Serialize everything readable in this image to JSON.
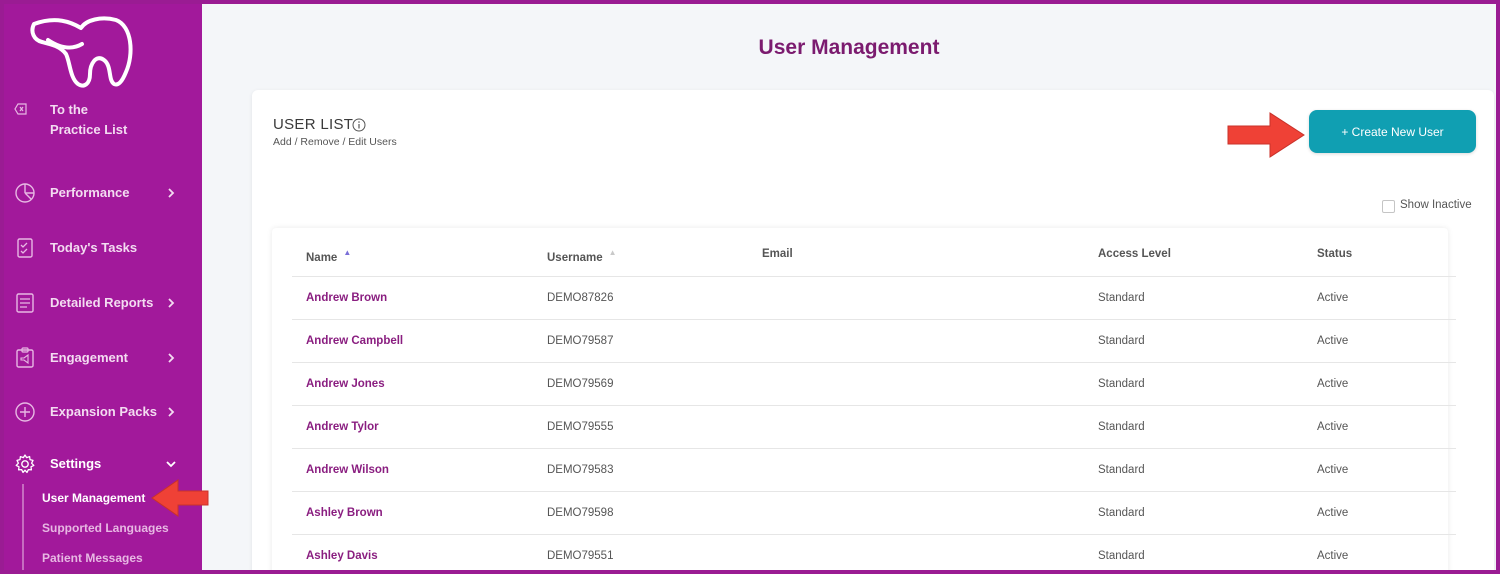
{
  "sidebar": {
    "back": {
      "line1": "To the",
      "line2": "Practice List"
    },
    "nav": [
      {
        "label": "Performance",
        "icon": "pie-chart-icon"
      },
      {
        "label": "Today's Tasks",
        "icon": "task-checklist-icon"
      },
      {
        "label": "Detailed Reports",
        "icon": "report-document-icon"
      },
      {
        "label": "Engagement",
        "icon": "clipboard-megaphone-icon"
      },
      {
        "label": "Expansion Packs",
        "icon": "plus-circle-icon"
      },
      {
        "label": "Settings",
        "icon": "gear-icon"
      }
    ],
    "sub_items": [
      "User Management",
      "Supported Languages",
      "Patient Messages"
    ]
  },
  "main": {
    "title": "User Management",
    "card": {
      "title": "USER LIST",
      "subtitle": "Add / Remove / Edit Users",
      "create_button": "+ Create New User",
      "show_inactive": "Show Inactive"
    },
    "table": {
      "columns": [
        "Name",
        "Username",
        "Email",
        "Access Level",
        "Status"
      ],
      "rows": [
        {
          "name": "Andrew Brown",
          "username": "DEMO87826",
          "email": "",
          "access": "Standard",
          "status": "Active"
        },
        {
          "name": "Andrew Campbell",
          "username": "DEMO79587",
          "email": "",
          "access": "Standard",
          "status": "Active"
        },
        {
          "name": "Andrew Jones",
          "username": "DEMO79569",
          "email": "",
          "access": "Standard",
          "status": "Active"
        },
        {
          "name": "Andrew Tylor",
          "username": "DEMO79555",
          "email": "",
          "access": "Standard",
          "status": "Active"
        },
        {
          "name": "Andrew Wilson",
          "username": "DEMO79583",
          "email": "",
          "access": "Standard",
          "status": "Active"
        },
        {
          "name": "Ashley Brown",
          "username": "DEMO79598",
          "email": "",
          "access": "Standard",
          "status": "Active"
        },
        {
          "name": "Ashley Davis",
          "username": "DEMO79551",
          "email": "",
          "access": "Standard",
          "status": "Active"
        }
      ]
    }
  },
  "colors": {
    "sidebar": "#a2199b",
    "accent_button": "#109fb2",
    "title": "#7b1b6f",
    "name_link": "#8a1e80",
    "annotation_arrow": "#ef4136"
  }
}
